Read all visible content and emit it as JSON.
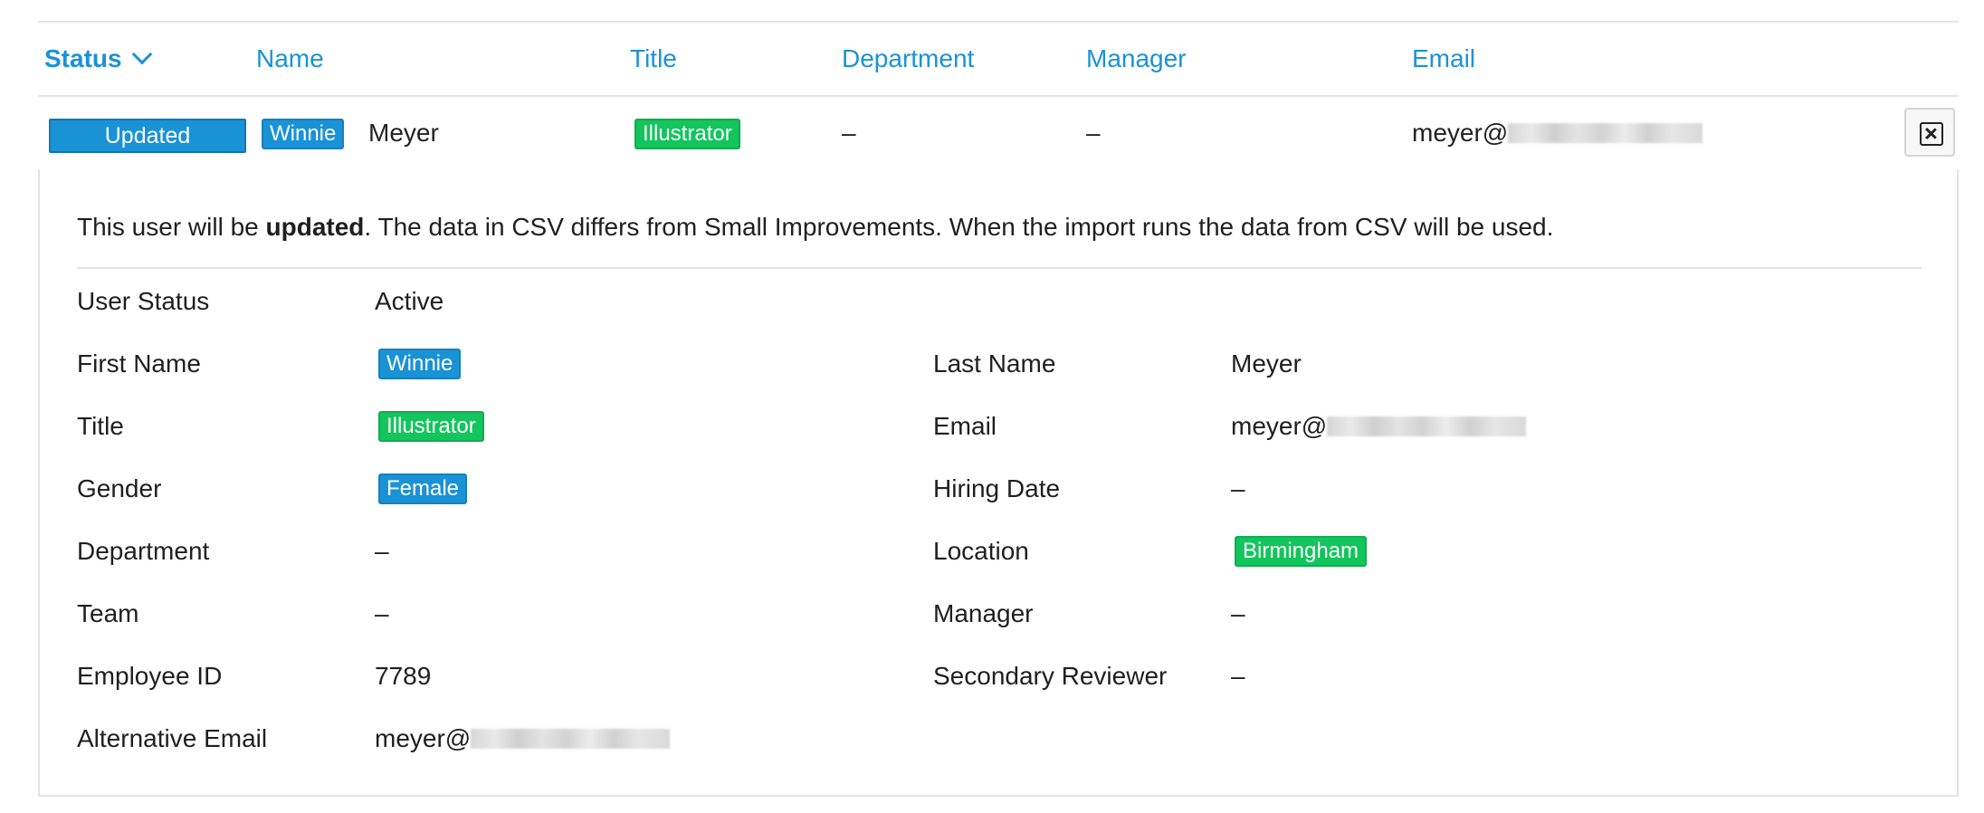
{
  "table": {
    "headers": {
      "status": "Status",
      "name": "Name",
      "title": "Title",
      "department": "Department",
      "manager": "Manager",
      "email": "Email"
    },
    "row": {
      "status": "Updated",
      "first_name": "Winnie",
      "last_name": "Meyer",
      "title": "Illustrator",
      "department": "–",
      "manager": "–",
      "email_visible": "meyer@"
    }
  },
  "detail": {
    "message_prefix": "This user will be ",
    "message_bold": "updated",
    "message_suffix": ". The data in CSV differs from Small Improvements. When the import runs the data from CSV will be used.",
    "fields_left": [
      {
        "label": "User Status",
        "value": "Active"
      },
      {
        "label": "First Name",
        "value": "Winnie"
      },
      {
        "label": "Title",
        "value": "Illustrator"
      },
      {
        "label": "Gender",
        "value": "Female"
      },
      {
        "label": "Department",
        "value": "–"
      },
      {
        "label": "Team",
        "value": "–"
      },
      {
        "label": "Employee ID",
        "value": "7789"
      },
      {
        "label": "Alternative Email",
        "value": "meyer@"
      }
    ],
    "fields_right": [
      {
        "label": "Last Name",
        "value": "Meyer"
      },
      {
        "label": "Email",
        "value": "meyer@"
      },
      {
        "label": "Hiring Date",
        "value": "–"
      },
      {
        "label": "Location",
        "value": "Birmingham"
      },
      {
        "label": "Manager",
        "value": "–"
      },
      {
        "label": "Secondary Reviewer",
        "value": "–"
      }
    ]
  },
  "colors": {
    "accent_blue": "#1a92d6",
    "changed_green": "#12c55c"
  },
  "icons": {
    "sort": "chevron-down-icon",
    "close": "close-box-icon"
  }
}
